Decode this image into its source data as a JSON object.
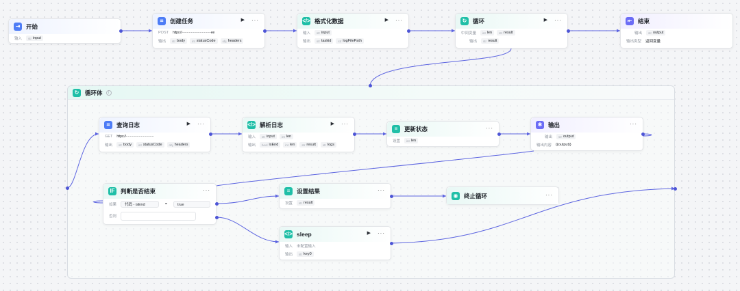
{
  "labels": {
    "input": "输入",
    "output": "输出",
    "output_type": "输出类型",
    "loop_var": "中间变量",
    "set": "设置",
    "output_content": "输出内容",
    "if": "如果",
    "else": "否则"
  },
  "type_abbr": {
    "string": "str",
    "int": "int",
    "bool": "bool",
    "object": "obj"
  },
  "nodes": {
    "start": {
      "title": "开始",
      "input_tag": "input",
      "input_type": "str"
    },
    "create_task": {
      "title": "创建任务",
      "method": "POST",
      "url": "https://·····························ee",
      "outputs": [
        {
          "type": "str",
          "name": "body"
        },
        {
          "type": "int",
          "name": "statusCode"
        },
        {
          "type": "obj",
          "name": "headers"
        }
      ]
    },
    "format_data": {
      "title": "格式化数据",
      "input": {
        "type": "str",
        "name": "input"
      },
      "outputs": [
        {
          "type": "str",
          "name": "taskid"
        },
        {
          "type": "str",
          "name": "logFilePath"
        }
      ]
    },
    "loop": {
      "title": "循环",
      "vars": [
        {
          "type": "int",
          "name": "len"
        },
        {
          "type": "str",
          "name": "result"
        }
      ],
      "output": {
        "type": "str",
        "name": "result"
      }
    },
    "end": {
      "title": "结束",
      "output": {
        "type": "str",
        "name": "output"
      },
      "output_type_value": "返回变量"
    },
    "query_log": {
      "title": "查询日志",
      "method": "GET",
      "url": "https://····························",
      "outputs": [
        {
          "type": "str",
          "name": "body"
        },
        {
          "type": "int",
          "name": "statusCode"
        },
        {
          "type": "obj",
          "name": "headers"
        }
      ]
    },
    "parse_log": {
      "title": "解析日志",
      "inputs": [
        {
          "type": "str",
          "name": "input"
        },
        {
          "type": "int",
          "name": "len"
        }
      ],
      "outputs": [
        {
          "type": "bool",
          "name": "isEnd"
        },
        {
          "type": "int",
          "name": "len"
        },
        {
          "type": "str",
          "name": "result"
        },
        {
          "type": "str",
          "name": "logs"
        }
      ]
    },
    "update_state": {
      "title": "更新状态",
      "set": {
        "type": "int",
        "name": "len"
      }
    },
    "output_node": {
      "title": "输出",
      "output": {
        "type": "str",
        "name": "output"
      },
      "output_content": "{{output}}"
    },
    "judge_end": {
      "title": "判断是否结束",
      "cond_left": "代码 - isEnd",
      "cond_op": "=",
      "cond_right": "true",
      "else_value": ""
    },
    "set_result": {
      "title": "设置结果",
      "set": {
        "type": "str",
        "name": "result"
      }
    },
    "stop_loop": {
      "title": "终止循环"
    },
    "sleep": {
      "title": "sleep",
      "input_value": "未配置输入",
      "output": {
        "type": "str",
        "name": "key0"
      }
    }
  },
  "group": {
    "title": "循环体"
  },
  "icons": {
    "run": "▶",
    "more": "···",
    "info": "i"
  },
  "colors": {
    "accent": "#4d55d6",
    "edge": "#5b63e0",
    "blue": "#4d7cf6",
    "teal": "#1fbfa7",
    "purple": "#6b6cf6"
  }
}
